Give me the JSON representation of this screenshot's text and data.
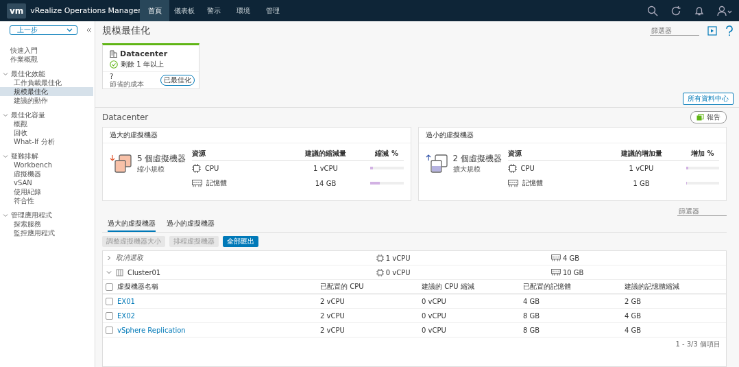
{
  "app": {
    "logo": "vm",
    "title": "vRealize Operations Manager"
  },
  "nav_tabs": [
    {
      "label": "首頁",
      "selected": true
    },
    {
      "label": "儀表板",
      "selected": false
    },
    {
      "label": "警示",
      "selected": false
    },
    {
      "label": "環境",
      "selected": false
    },
    {
      "label": "管理",
      "selected": false
    }
  ],
  "sidebar": {
    "back": "上一步",
    "items": [
      {
        "label": "快速入門",
        "selected": false
      },
      {
        "label": "作業概觀",
        "selected": false
      }
    ],
    "groups": [
      {
        "label": "最佳化效能",
        "expanded": true,
        "children": [
          {
            "label": "工作負載最佳化",
            "selected": false
          },
          {
            "label": "規模最佳化",
            "selected": true
          },
          {
            "label": "建議的動作",
            "selected": false
          }
        ]
      },
      {
        "label": "最佳化容量",
        "expanded": true,
        "children": [
          {
            "label": "概觀",
            "selected": false
          },
          {
            "label": "回收",
            "selected": false
          },
          {
            "label": "What-If 分析",
            "selected": false
          }
        ]
      },
      {
        "label": "疑難排解",
        "expanded": true,
        "children": [
          {
            "label": "Workbench",
            "selected": false
          },
          {
            "label": "虛擬機器",
            "selected": false
          },
          {
            "label": "vSAN",
            "selected": false
          },
          {
            "label": "使用紀錄",
            "selected": false
          },
          {
            "label": "符合性",
            "selected": false
          }
        ]
      },
      {
        "label": "管理應用程式",
        "expanded": true,
        "children": [
          {
            "label": "探索服務",
            "selected": false
          },
          {
            "label": "監控應用程式",
            "selected": false
          }
        ]
      }
    ]
  },
  "page": {
    "title": "規模最佳化",
    "filter_placeholder": "篩選器"
  },
  "dc_card": {
    "name": "Datacenter",
    "status": "剩餘 1 年以上",
    "value": "?",
    "caption": "節省的成本",
    "badge": "已最佳化"
  },
  "all_dc_button": "所有資料中心",
  "section": {
    "title": "Datacenter",
    "action": "報告"
  },
  "panels": [
    {
      "title": "過大的虛擬機器",
      "kind": "shrink",
      "count": "5 個虛擬機器",
      "subtitle": "縮小規模",
      "columns": [
        "資源",
        "建議的縮減量",
        "縮減 %"
      ],
      "rows": [
        {
          "resource": "CPU",
          "kind": "cpu",
          "amount": "1 vCPU",
          "level": 0.08
        },
        {
          "resource": "記憶體",
          "kind": "memory",
          "amount": "14 GB",
          "level": 0.28
        }
      ]
    },
    {
      "title": "過小的虛擬機器",
      "kind": "grow",
      "count": "2 個虛擬機器",
      "subtitle": "擴大規模",
      "columns": [
        "資源",
        "建議的增加量",
        "增加 %"
      ],
      "rows": [
        {
          "resource": "CPU",
          "kind": "cpu",
          "amount": "1 vCPU",
          "level": 0.08
        },
        {
          "resource": "記憶體",
          "kind": "memory",
          "amount": "1 GB",
          "level": 0.03
        }
      ]
    }
  ],
  "list": {
    "filter_placeholder": "篩選器",
    "tabs": [
      {
        "label": "過大的虛擬機器",
        "selected": true
      },
      {
        "label": "過小的虛擬機器",
        "selected": false
      }
    ],
    "buttons": [
      {
        "label": "調整虛擬機器大小",
        "disabled": true
      },
      {
        "label": "排程虛擬機器",
        "disabled": true
      },
      {
        "label": "全部匯出",
        "disabled": false
      }
    ],
    "groups": [
      {
        "name": "取消選取",
        "expanded": false,
        "kind": "unassigned",
        "cpu": "1 vCPU",
        "memory": "4 GB"
      },
      {
        "name": "Cluster01",
        "expanded": true,
        "kind": "cluster",
        "cpu": "0 vCPU",
        "memory": "10 GB"
      }
    ],
    "all_checked": false,
    "columns": [
      "虛擬機器名稱",
      "已配置的 CPU",
      "建議的 CPU 縮減",
      "已配置的記憶體",
      "建議的記憶體縮減"
    ],
    "rows": [
      {
        "checked": false,
        "cells": [
          "EX01",
          "2 vCPU",
          "0 vCPU",
          "4 GB",
          "2 GB"
        ]
      },
      {
        "checked": false,
        "cells": [
          "EX02",
          "2 vCPU",
          "0 vCPU",
          "8 GB",
          "4 GB"
        ]
      },
      {
        "checked": false,
        "cells": [
          "vSphere Replication",
          "2 vCPU",
          "0 vCPU",
          "8 GB",
          "4 GB"
        ]
      }
    ],
    "footer": "1 - 3/3 個項目"
  }
}
